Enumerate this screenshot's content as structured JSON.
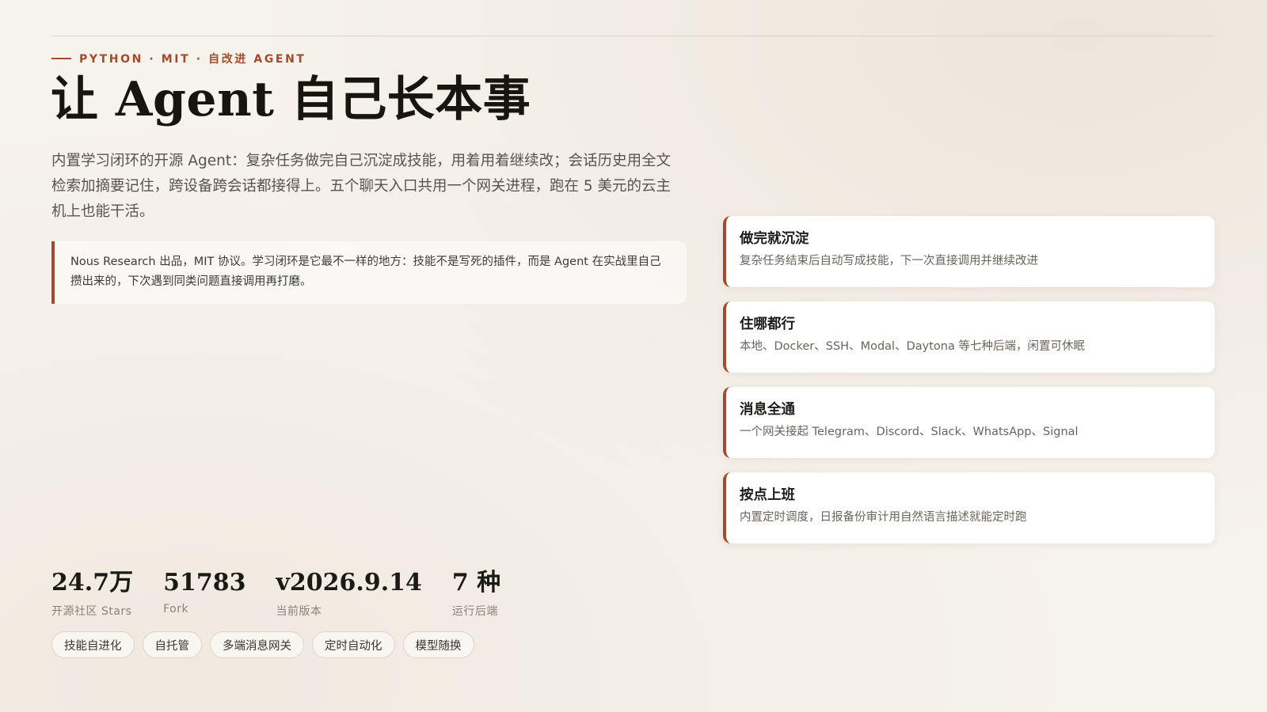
{
  "header": {
    "eyebrow": "PYTHON · MIT · 自改进 AGENT",
    "title": "让 Agent 自己长本事",
    "lead": "内置学习闭环的开源 Agent：复杂任务做完自己沉淀成技能，用着用着继续改；会话历史用全文检索加摘要记住，跨设备跨会话都接得上。五个聊天入口共用一个网关进程，跑在 5 美元的云主机上也能干活。"
  },
  "callout": {
    "text": "Nous Research 出品，MIT 协议。学习闭环是它最不一样的地方：技能不是写死的插件，而是 Agent 在实战里自己攒出来的，下次遇到同类问题直接调用再打磨。"
  },
  "features": [
    {
      "title": "做完就沉淀",
      "desc": "复杂任务结束后自动写成技能，下一次直接调用并继续改进"
    },
    {
      "title": "住哪都行",
      "desc": "本地、Docker、SSH、Modal、Daytona 等七种后端，闲置可休眠"
    },
    {
      "title": "消息全通",
      "desc": "一个网关接起 Telegram、Discord、Slack、WhatsApp、Signal"
    },
    {
      "title": "按点上班",
      "desc": "内置定时调度，日报备份审计用自然语言描述就能定时跑"
    }
  ],
  "stats": [
    {
      "value": "24.7万",
      "label": "开源社区 Stars"
    },
    {
      "value": "51783",
      "label": "Fork"
    },
    {
      "value": "v2026.9.14",
      "label": "当前版本"
    },
    {
      "value": "7 种",
      "label": "运行后端"
    }
  ],
  "tags": [
    "技能自进化",
    "自托管",
    "多端消息网关",
    "定时自动化",
    "模型随换"
  ],
  "colors": {
    "accent": "#a44a2a",
    "background": "#f6f3ec",
    "card": "#ffffff",
    "text": "#1c1a17",
    "muted": "#8b837a"
  }
}
